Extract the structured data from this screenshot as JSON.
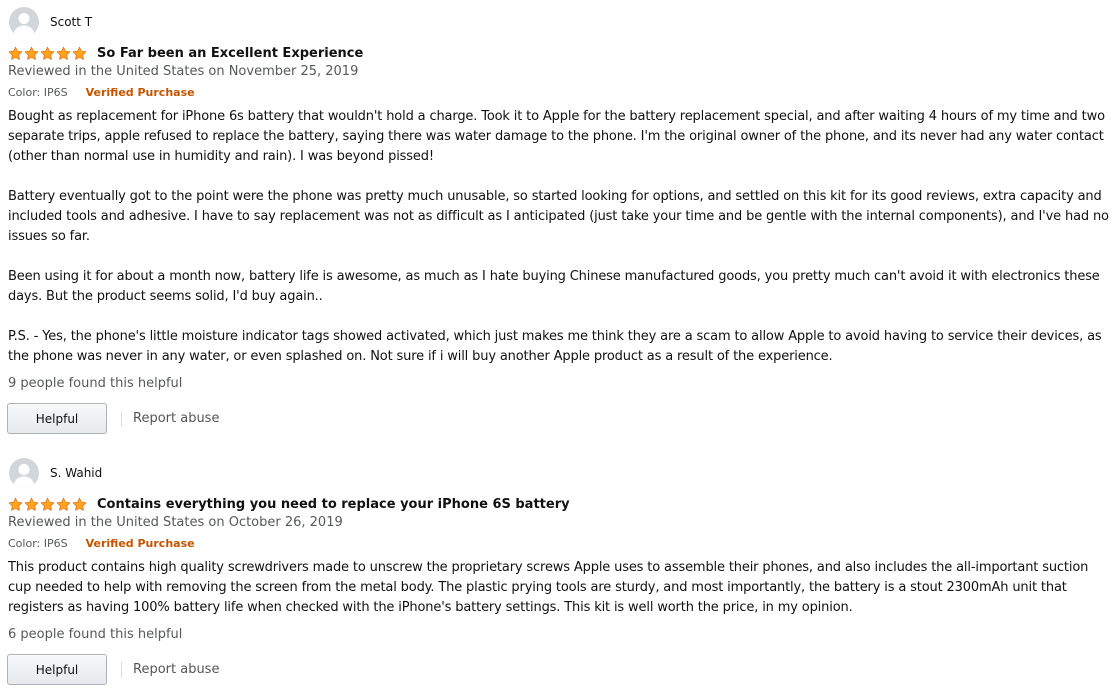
{
  "reviews": [
    {
      "author": "Scott T",
      "rating": 5,
      "title": "So Far been an Excellent Experience",
      "date": "Reviewed in the United States on November 25, 2019",
      "format": "Color: IP6S",
      "verified": "Verified Purchase",
      "body": [
        "Bought as replacement for iPhone 6s battery that wouldn't hold a charge. Took it to Apple for the battery replacement special, and after waiting 4 hours of my time and two separate trips, apple refused to replace the battery, saying there was water damage to the phone. I'm the original owner of the phone, and its never had any water contact (other than normal use in humidity and rain). I was beyond pissed!",
        "Battery eventually got to the point were the phone was pretty much unusable, so started looking for options, and settled on this kit for its good reviews, extra capacity and included tools and adhesive. I have to say replacement was not as difficult as I anticipated (just take your time and be gentle with the internal components), and I've had no issues so far.",
        "Been using it for about a month now, battery life is awesome, as much as I hate buying Chinese manufactured goods, you pretty much can't avoid it with electronics these days. But the product seems solid, I'd buy again..",
        "P.S. - Yes, the phone's little moisture indicator tags showed activated, which just makes me think they are a scam to allow Apple to avoid having to service their devices, as the phone was never in any water, or even splashed on. Not sure if i will buy another Apple product as a result of the experience."
      ],
      "helpful_count": "9 people found this helpful",
      "helpful_label": "Helpful",
      "report_label": "Report abuse"
    },
    {
      "author": "S. Wahid",
      "rating": 5,
      "title": "Contains everything you need to replace your iPhone 6S battery",
      "date": "Reviewed in the United States on October 26, 2019",
      "format": "Color: IP6S",
      "verified": "Verified Purchase",
      "body": [
        "This product contains high quality screwdrivers made to unscrew the proprietary screws Apple uses to assemble their phones, and also includes the all-important suction cup needed to help with removing the screen from the metal body. The plastic prying tools are sturdy, and most importantly, the battery is a stout 2300mAh unit that registers as having 100% battery life when checked with the iPhone's battery settings. This kit is well worth the price, in my opinion."
      ],
      "helpful_count": "6 people found this helpful",
      "helpful_label": "Helpful",
      "report_label": "Report abuse"
    }
  ],
  "colors": {
    "star": "#ffa41c",
    "star_stroke": "#de7921",
    "verified": "#c45500",
    "muted": "#565959"
  },
  "icons": {
    "avatar": "default-profile-avatar-icon",
    "star": "star-filled-icon"
  }
}
